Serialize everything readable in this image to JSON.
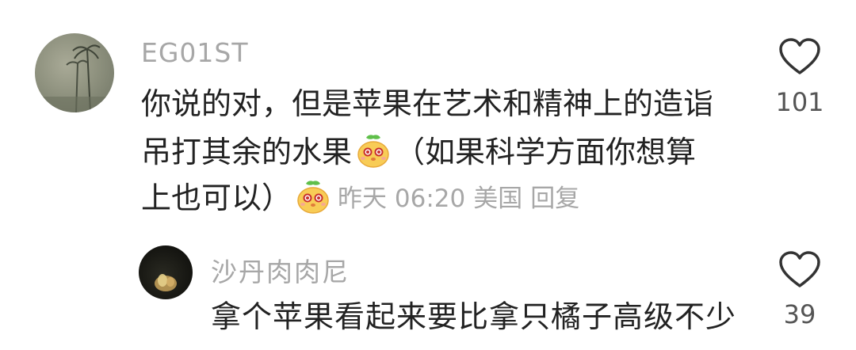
{
  "comment": {
    "username": "EG01ST",
    "lines": [
      "你说的对，但是苹果在艺术和精神上的造诣",
      "吊打其余的水果",
      "（如果科学方面你想算",
      "上也可以）"
    ],
    "emoji_name": "cute-fruit-emoji",
    "time": "昨天 06:20",
    "location": "美国",
    "reply_label": "回复",
    "likes": "101"
  },
  "reply": {
    "username": "沙丹肉肉尼",
    "text": "拿个苹果看起来要比拿只橘子高级不少",
    "likes": "39"
  },
  "icons": {
    "like": "heart-outline-icon"
  },
  "colors": {
    "text": "#222222",
    "muted": "#a7a7a7",
    "count": "#555555"
  }
}
